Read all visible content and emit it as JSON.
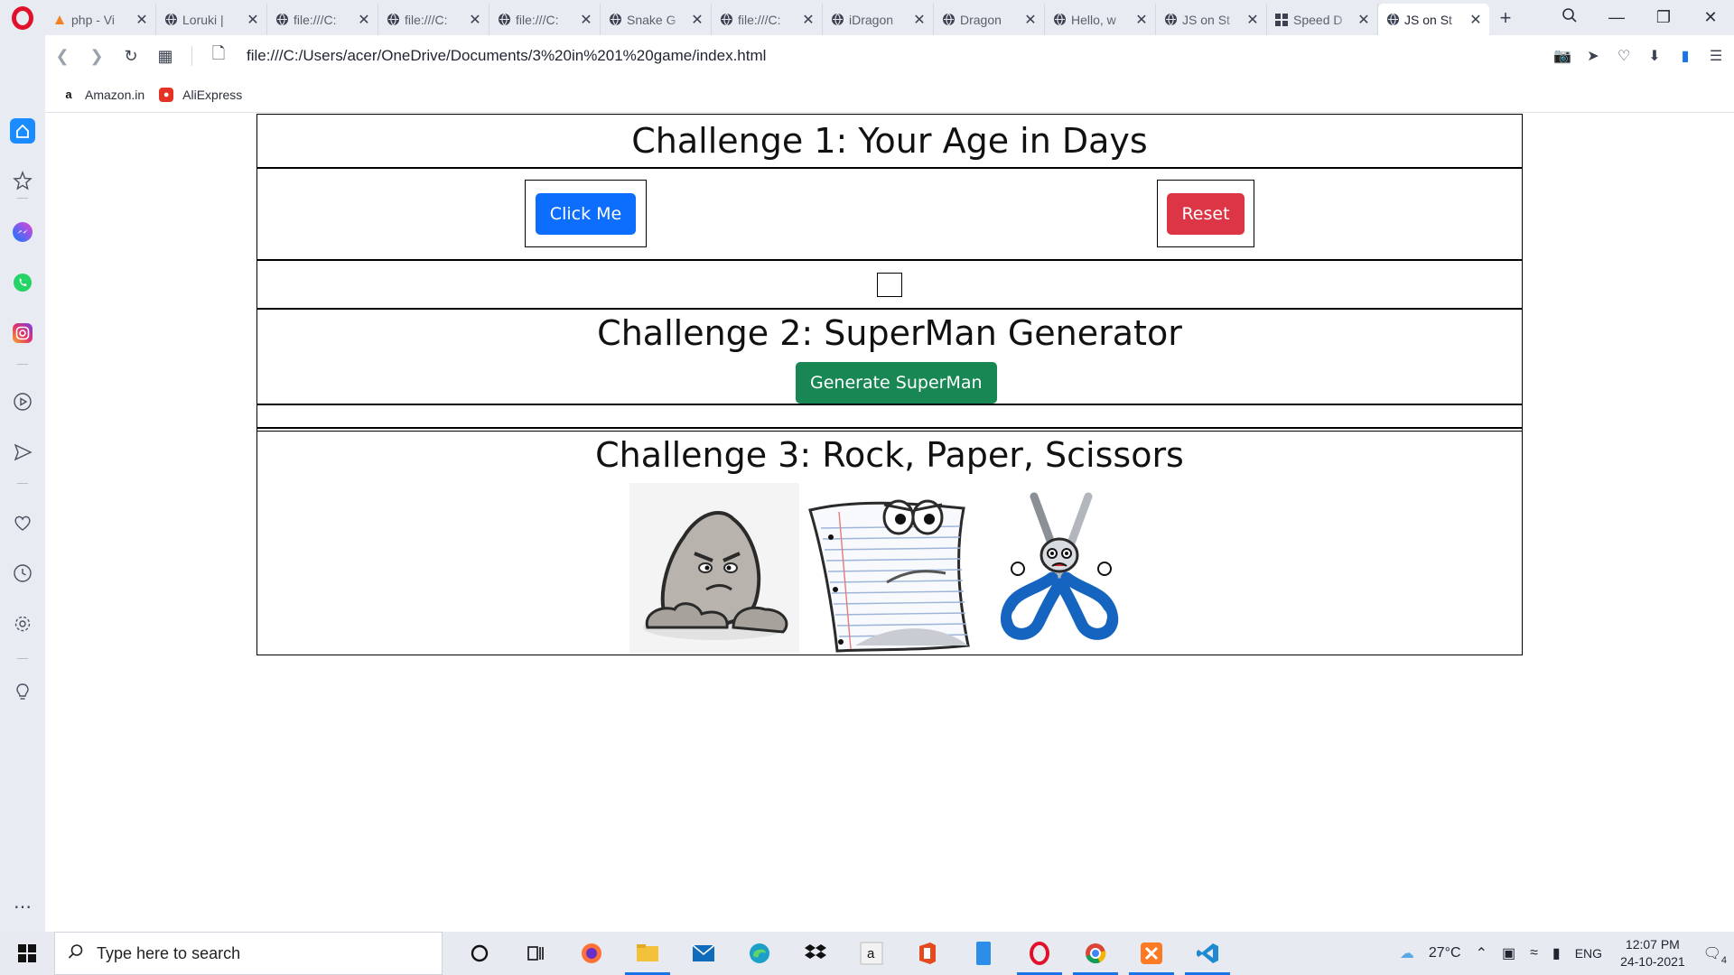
{
  "browser": {
    "tabs": [
      {
        "title": "php - Vi",
        "icon": "php-favicon"
      },
      {
        "title": "Loruki |",
        "icon": "globe-favicon"
      },
      {
        "title": "file:///C:",
        "icon": "globe-favicon"
      },
      {
        "title": "file:///C:",
        "icon": "globe-favicon"
      },
      {
        "title": "file:///C:",
        "icon": "globe-favicon"
      },
      {
        "title": "Snake G",
        "icon": "globe-favicon"
      },
      {
        "title": "file:///C:",
        "icon": "globe-favicon"
      },
      {
        "title": "iDragon",
        "icon": "globe-favicon"
      },
      {
        "title": "Dragon",
        "icon": "globe-favicon"
      },
      {
        "title": "Hello, w",
        "icon": "globe-favicon"
      },
      {
        "title": "JS on St",
        "icon": "globe-favicon"
      },
      {
        "title": "Speed D",
        "icon": "speed-dial-favicon"
      },
      {
        "title": "JS on St",
        "icon": "globe-favicon",
        "active": true
      }
    ],
    "url": "file:///C:/Users/acer/OneDrive/Documents/3%20in%201%20game/index.html",
    "bookmarks": [
      {
        "label": "Amazon.in",
        "icon": "amazon-icon"
      },
      {
        "label": "AliExpress",
        "icon": "aliexpress-icon"
      }
    ],
    "accent": "#e0112b"
  },
  "page": {
    "challenge1": {
      "title": "Challenge 1: Your Age in Days",
      "click_label": "Click Me",
      "reset_label": "Reset"
    },
    "challenge2": {
      "title": "Challenge 2: SuperMan Generator",
      "generate_label": "Generate SuperMan"
    },
    "challenge3": {
      "title": "Challenge 3: Rock, Paper, Scissors",
      "choices": [
        "rock",
        "paper",
        "scissors"
      ]
    },
    "colors": {
      "primary": "#0d6efd",
      "danger": "#dc3545",
      "success": "#198754"
    }
  },
  "taskbar": {
    "search_placeholder": "Type here to search",
    "temperature": "27°C",
    "language": "ENG",
    "time": "12:07 PM",
    "date": "24-10-2021",
    "notifications": "4"
  }
}
